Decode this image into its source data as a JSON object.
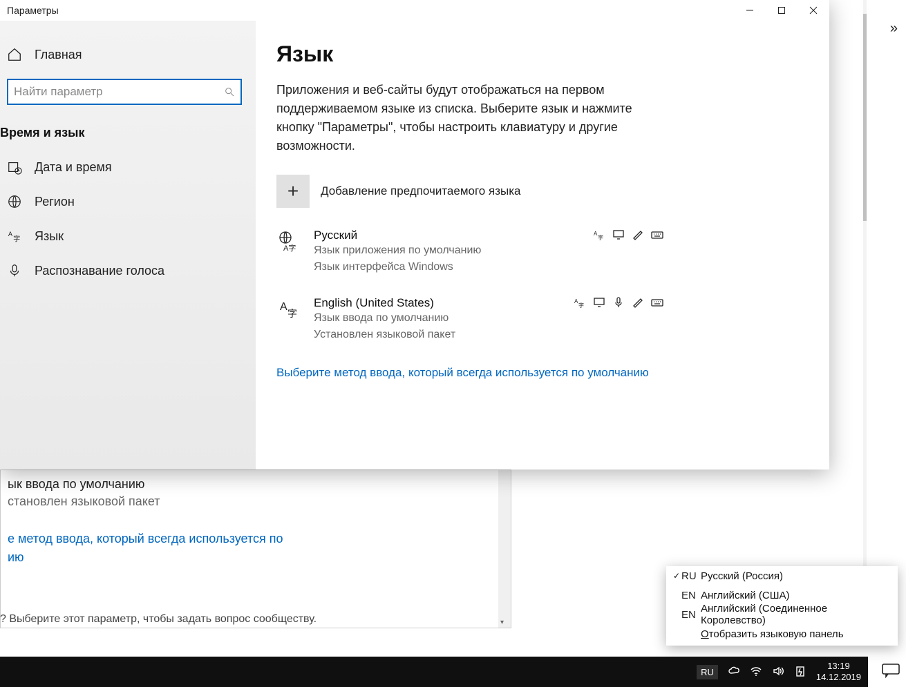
{
  "titlebar": {
    "title": "Параметры"
  },
  "sidebar": {
    "home": "Главная",
    "search_placeholder": "Найти параметр",
    "category": "Время и язык",
    "items": [
      {
        "label": "Дата и время"
      },
      {
        "label": "Регион"
      },
      {
        "label": "Язык"
      },
      {
        "label": "Распознавание голоса"
      }
    ]
  },
  "main": {
    "heading": "Язык",
    "description": "Приложения и веб-сайты будут отображаться на первом поддерживаемом языке из списка. Выберите язык и нажмите кнопку \"Параметры\", чтобы настроить клавиатуру и другие возможности.",
    "add_label": "Добавление предпочитаемого языка",
    "languages": [
      {
        "name": "Русский",
        "sub1": "Язык приложения по умолчанию",
        "sub2": "Язык интерфейса Windows"
      },
      {
        "name": "English (United States)",
        "sub1": "Язык ввода по умолчанию",
        "sub2": "Установлен языковой пакет"
      }
    ],
    "link": "Выберите метод ввода, который всегда используется по умолчанию"
  },
  "background_window": {
    "line1": "ык ввода по умолчанию",
    "line2": "становлен языковой пакет",
    "link": "е метод ввода, который всегда используется по\nию",
    "question": "? Выберите этот параметр, чтобы задать вопрос сообществу."
  },
  "flyout": {
    "items": [
      {
        "checked": true,
        "code": "RU",
        "name": "Русский (Россия)"
      },
      {
        "checked": false,
        "code": "EN",
        "name": "Английский (США)"
      },
      {
        "checked": false,
        "code": "EN",
        "name": "Английский (Соединенное Королевство)"
      }
    ],
    "showbar_pre": "О",
    "showbar_rest": "тобразить языковую панель"
  },
  "taskbar": {
    "lang": "RU",
    "time": "13:19",
    "date": "14.12.2019"
  },
  "overflow_chevron": "»"
}
